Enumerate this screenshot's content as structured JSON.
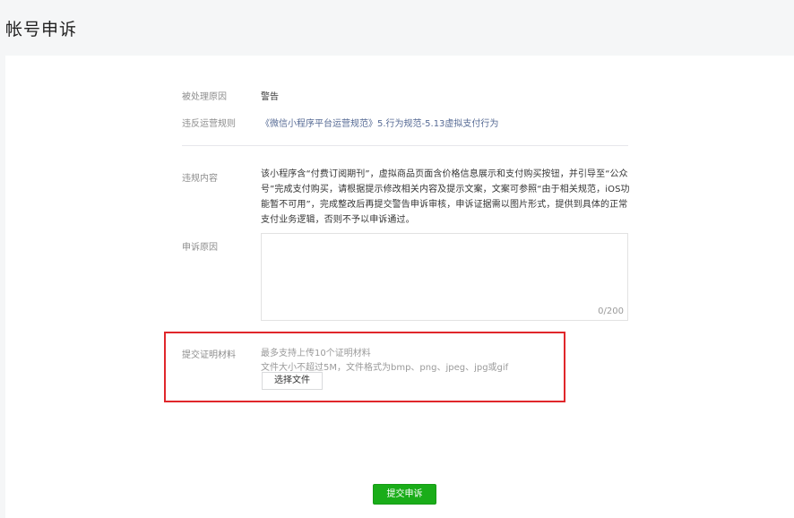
{
  "page": {
    "title": "帐号申诉"
  },
  "form": {
    "reason_label": "被处理原因",
    "reason_value": "警告",
    "rule_label": "违反运营规则",
    "rule_value": "《微信小程序平台运营规范》5.行为规范-5.13虚拟支付行为",
    "violation_label": "违规内容",
    "violation_text": "该小程序含“付费订阅期刊”，虚拟商品页面含价格信息展示和支付购买按钮，并引导至“公众号”完成支付购买，请根据提示修改相关内容及提示文案，文案可参照“由于相关规范，iOS功能暂不可用”，完成整改后再提交警告申诉审核，申诉证据需以图片形式，提供到具体的正常支付业务逻辑，否则不予以申诉通过。",
    "appeal_label": "申诉原因",
    "appeal_value": "",
    "appeal_counter": "0/200",
    "evidence_label": "提交证明材料",
    "evidence_hint_1": "最多支持上传10个证明材料",
    "evidence_hint_2": "文件大小不超过5M，文件格式为bmp、png、jpeg、jpg或gif",
    "choose_file_label": "选择文件"
  },
  "actions": {
    "submit_label": "提交申诉"
  },
  "colors": {
    "primary": "#1aad19",
    "link": "#576b95",
    "highlight": "#e0272b"
  }
}
